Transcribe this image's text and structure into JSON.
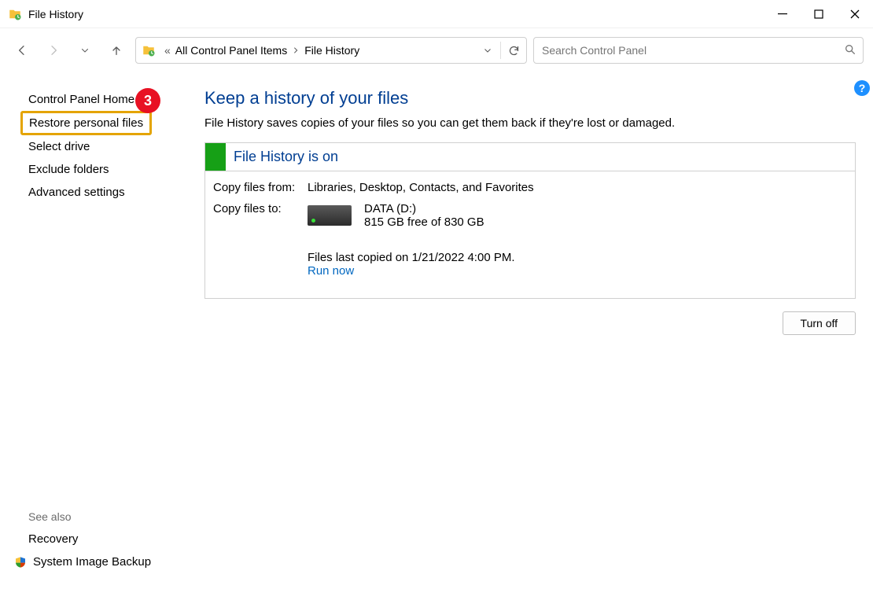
{
  "window": {
    "title": "File History"
  },
  "breadcrumb": {
    "item1": "All Control Panel Items",
    "item2": "File History"
  },
  "search": {
    "placeholder": "Search Control Panel"
  },
  "sidebar": {
    "home": "Control Panel Home",
    "restore": "Restore personal files",
    "select_drive": "Select drive",
    "exclude": "Exclude folders",
    "advanced": "Advanced settings",
    "see_also": "See also",
    "recovery": "Recovery",
    "sys_image": "System Image Backup"
  },
  "annotation": {
    "badge": "3"
  },
  "main": {
    "heading": "Keep a history of your files",
    "description": "File History saves copies of your files so you can get them back if they're lost or damaged.",
    "status_title": "File History is on",
    "copy_from_label": "Copy files from:",
    "copy_from_value": "Libraries, Desktop, Contacts, and Favorites",
    "copy_to_label": "Copy files to:",
    "drive_name": "DATA (D:)",
    "drive_free": "815 GB free of 830 GB",
    "last_copied": "Files last copied on 1/21/2022 4:00 PM.",
    "run_now": "Run now",
    "turn_off": "Turn off"
  }
}
